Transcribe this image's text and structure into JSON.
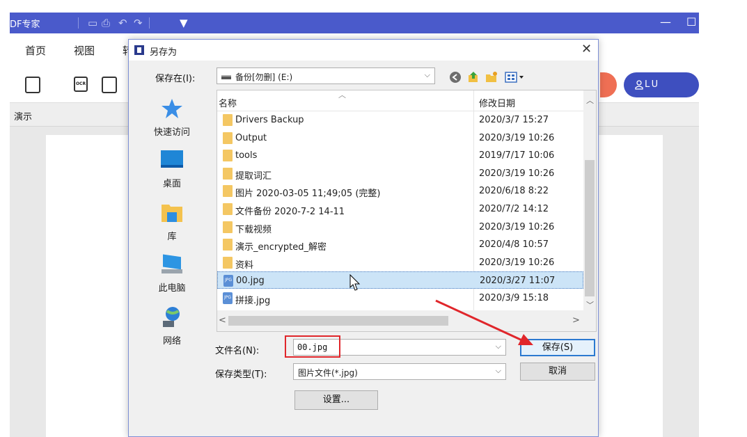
{
  "app": {
    "title": "DF专家",
    "menu": [
      "首页",
      "视图",
      "转"
    ],
    "tab_label": "演示",
    "user_label": "LU",
    "accent_color": "#4a5acb"
  },
  "dialog": {
    "title": "另存为",
    "save_in_label": "保存在(I):",
    "location": "备份[勿删] (E:)",
    "sidebar": [
      "快速访问",
      "桌面",
      "库",
      "此电脑",
      "网络"
    ],
    "columns": {
      "name": "名称",
      "date": "修改日期"
    },
    "files": [
      {
        "name": "Drivers Backup",
        "date": "2020/3/7 15:27",
        "type": "folder"
      },
      {
        "name": "Output",
        "date": "2020/3/19 10:26",
        "type": "folder"
      },
      {
        "name": "tools",
        "date": "2019/7/17 10:06",
        "type": "folder"
      },
      {
        "name": "提取词汇",
        "date": "2020/3/19 10:26",
        "type": "folder"
      },
      {
        "name": "图片 2020-03-05 11;49;05 (完整)",
        "date": "2020/6/18 8:22",
        "type": "folder"
      },
      {
        "name": "文件备份 2020-7-2 14-11",
        "date": "2020/7/2 14:12",
        "type": "folder"
      },
      {
        "name": "下载视频",
        "date": "2020/3/19 10:26",
        "type": "folder"
      },
      {
        "name": "演示_encrypted_解密",
        "date": "2020/4/8 10:57",
        "type": "folder"
      },
      {
        "name": "资料",
        "date": "2020/3/19 10:26",
        "type": "folder"
      },
      {
        "name": "00.jpg",
        "date": "2020/3/27 11:07",
        "type": "jpg",
        "selected": true
      },
      {
        "name": "拼接.jpg",
        "date": "2020/3/9 15:18",
        "type": "jpg"
      }
    ],
    "filename_label": "文件名(N):",
    "filename_value": "00.jpg",
    "filetype_label": "保存类型(T):",
    "filetype_value": "图片文件(*.jpg)",
    "save_button": "保存(S)",
    "cancel_button": "取消",
    "settings_button": "设置..."
  }
}
